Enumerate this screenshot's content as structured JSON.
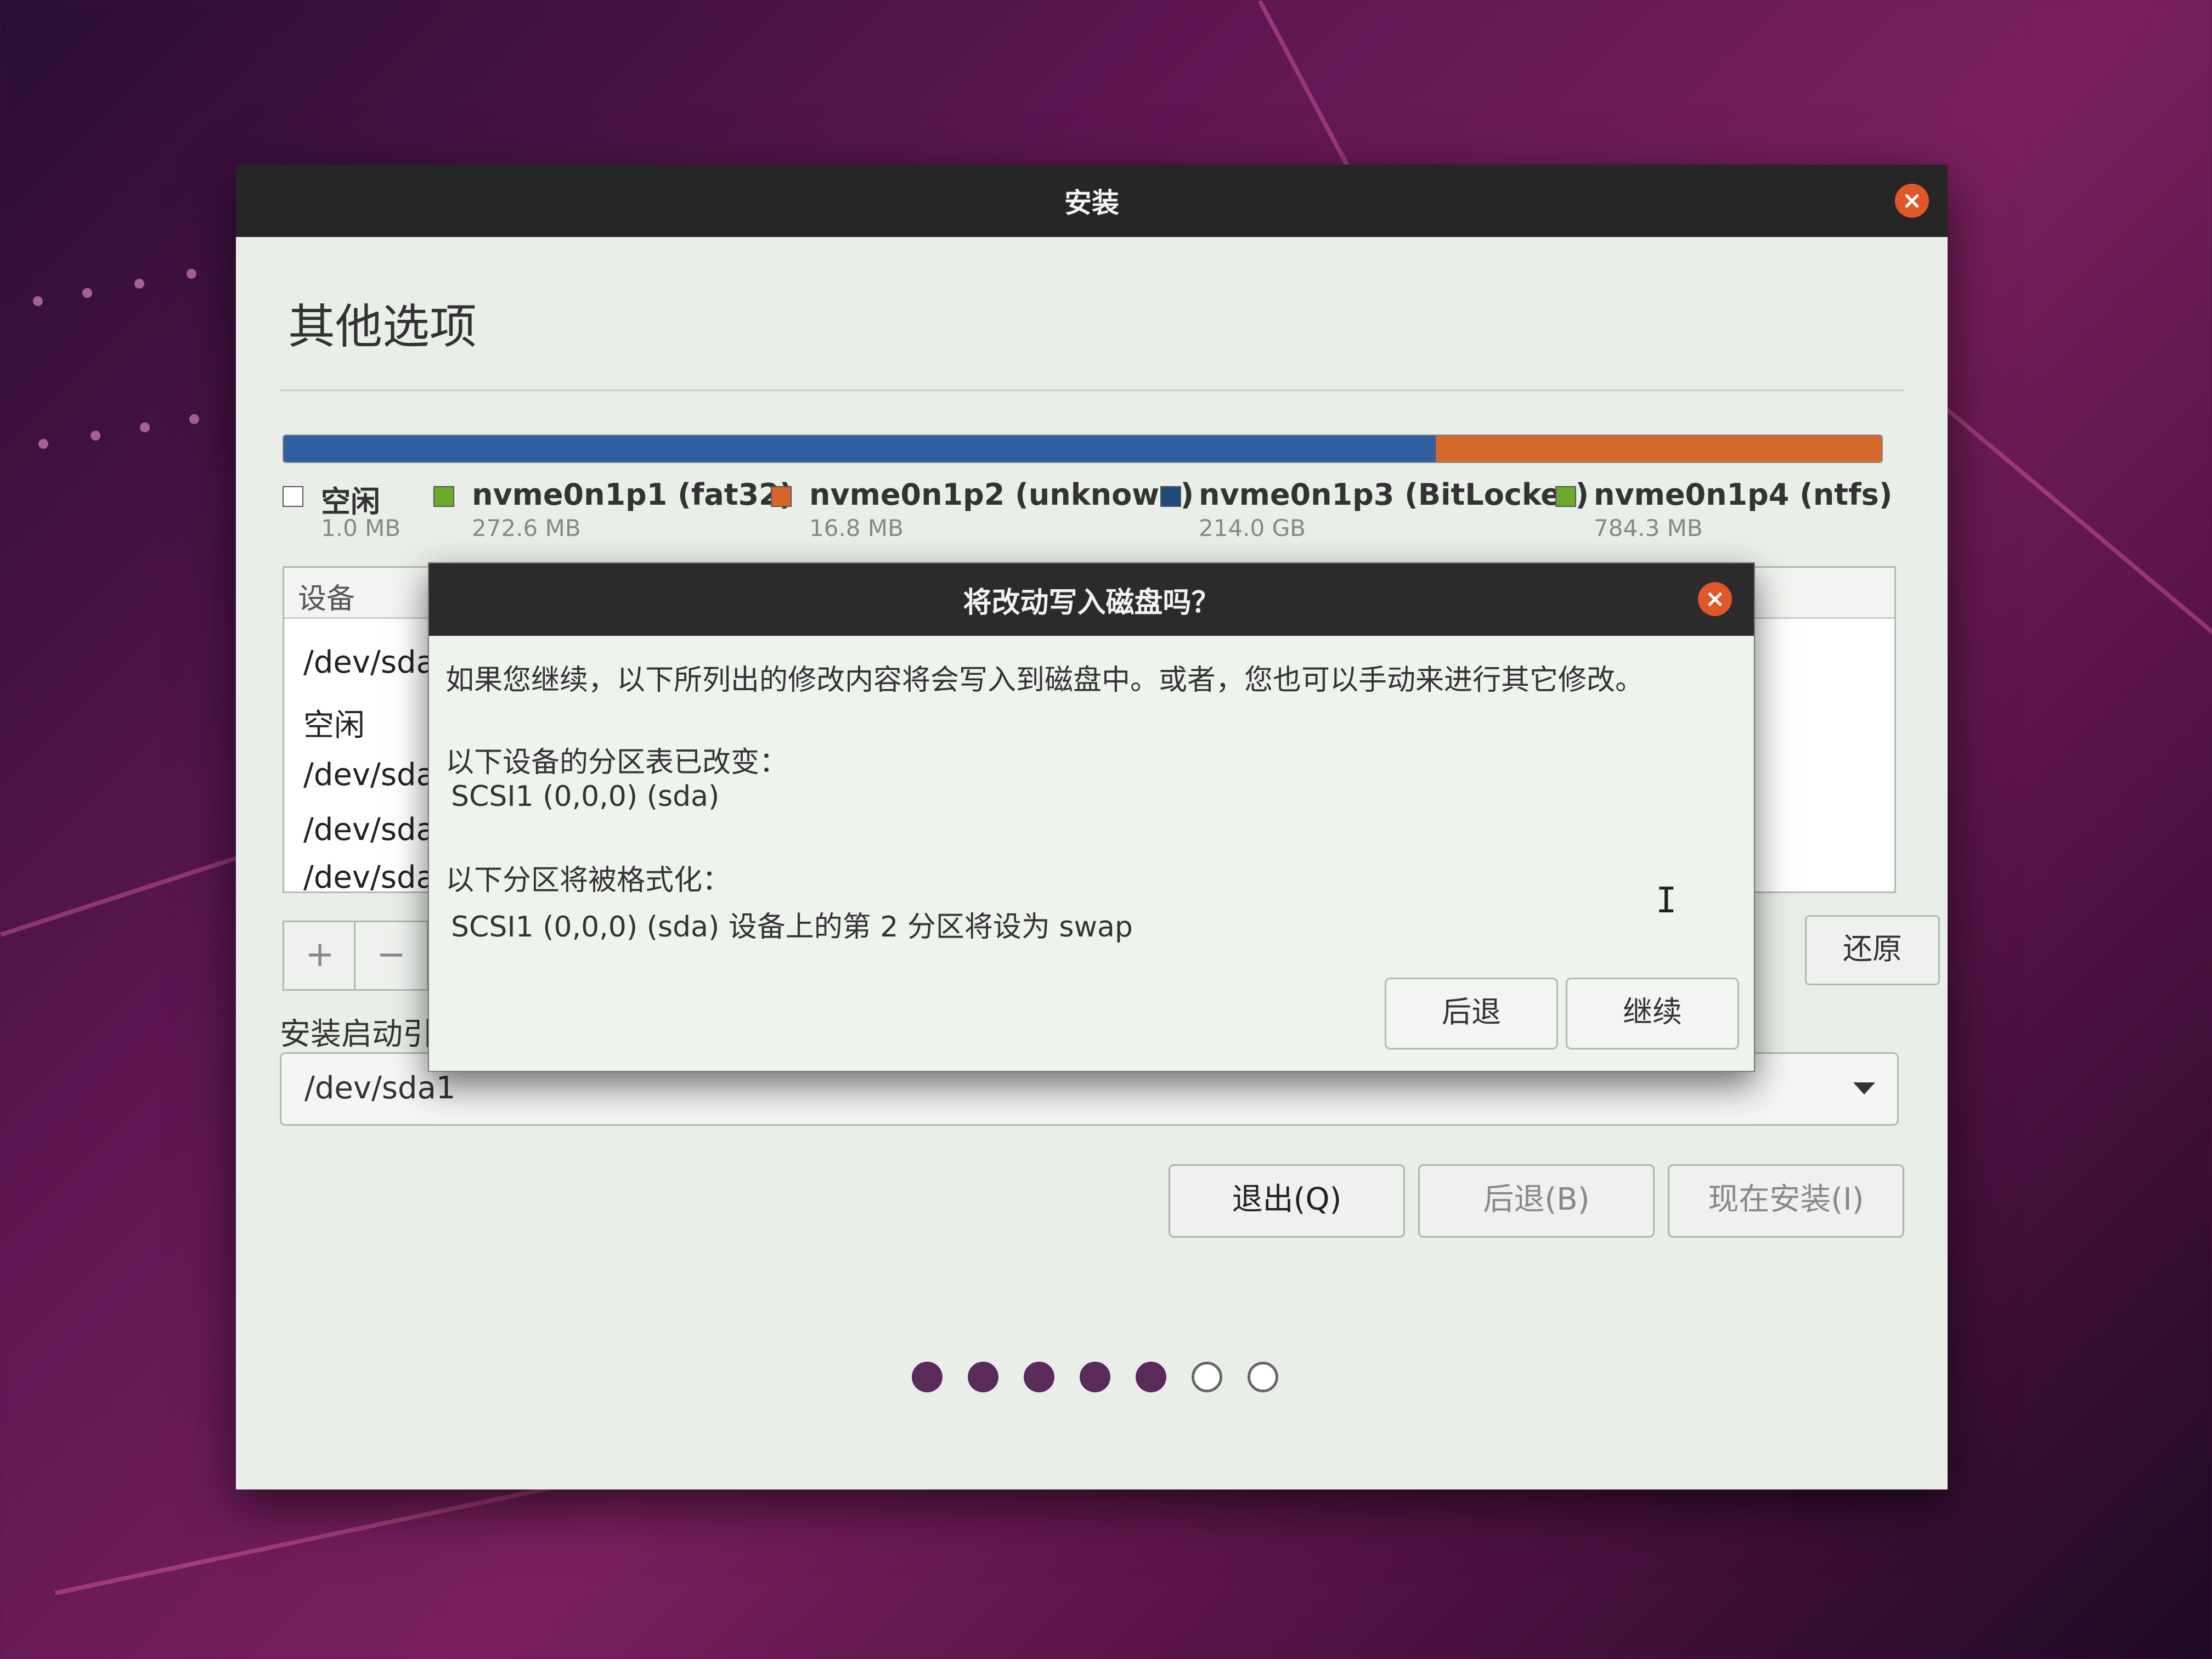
{
  "window": {
    "title": "安装",
    "page_title": "其他选项"
  },
  "partition_legend": [
    {
      "name": "空闲",
      "size": "1.0 MB",
      "color": "#ffffff"
    },
    {
      "name": "nvme0n1p1 (fat32)",
      "size": "272.6 MB",
      "color": "#6bab2c"
    },
    {
      "name": "nvme0n1p2 (unknown)",
      "size": "16.8 MB",
      "color": "#d9642a"
    },
    {
      "name": "nvme0n1p3 (BitLocker)",
      "size": "214.0 GB",
      "color": "#1f4a7a"
    },
    {
      "name": "nvme0n1p4 (ntfs)",
      "size": "784.3 MB",
      "color": "#6bab2c"
    }
  ],
  "device_table": {
    "header": "设备",
    "rows": [
      "/dev/sda",
      "空闲",
      "/dev/sda",
      "/dev/sda",
      "/dev/sda"
    ]
  },
  "toolbar": {
    "add_label": "+",
    "remove_label": "−",
    "revert_label": "还原"
  },
  "bootloader": {
    "label": "安装启动引",
    "value": "/dev/sda1"
  },
  "actions": {
    "quit": "退出(Q)",
    "back": "后退(B)",
    "install": "现在安装(I)"
  },
  "dialog": {
    "title": "将改动写入磁盘吗？",
    "intro": "如果您继续，以下所列出的修改内容将会写入到磁盘中。或者，您也可以手动来进行其它修改。",
    "partition_table_heading": "以下设备的分区表已改变：",
    "partition_table_device": "SCSI1 (0,0,0) (sda)",
    "format_heading": "以下分区将被格式化：",
    "format_item": "SCSI1 (0,0,0) (sda) 设备上的第 2 分区将设为 swap",
    "back_label": "后退",
    "continue_label": "继续"
  },
  "progress": {
    "steps_total": 7,
    "steps_done": 5
  }
}
